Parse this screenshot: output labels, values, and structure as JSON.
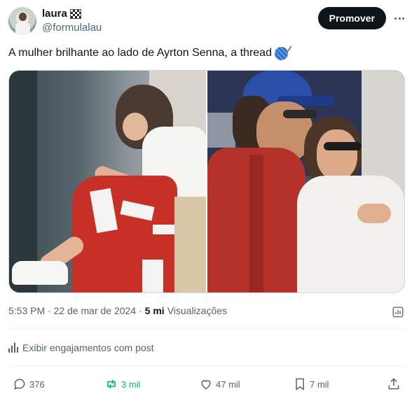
{
  "tweet": {
    "author": {
      "display_name": "laura",
      "display_icon": "checkered-flag-icon",
      "handle": "@formulalau"
    },
    "promote_label": "Promover",
    "text": "A mulher brilhante ao lado de Ayrton Senna, a thread",
    "text_emoji": "yarn-ball-icon",
    "timestamp": "5:53 PM · 22 de mar de 2024 ·",
    "views_count": "5 mi",
    "views_label": "Visualizações",
    "engagements_label": "Exibir engajamentos com post",
    "actions": {
      "replies": "376",
      "reposts": "3 mil",
      "likes": "47 mil",
      "bookmarks": "7 mil"
    }
  },
  "colors": {
    "text": "#0f1419",
    "muted": "#536471",
    "repost_green": "#00ba7c",
    "promote_bg": "#0f1419"
  }
}
